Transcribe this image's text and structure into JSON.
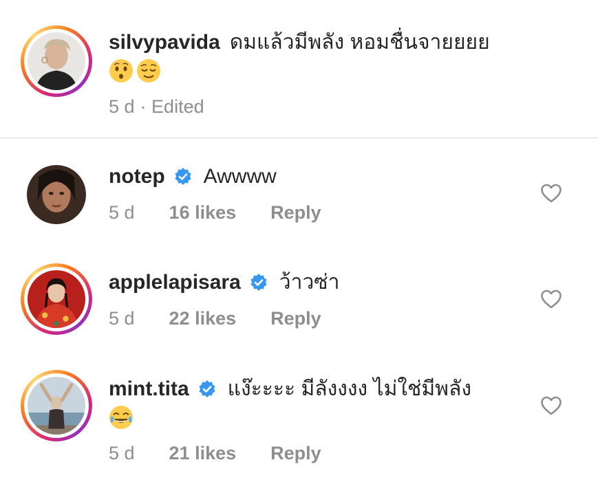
{
  "comments": [
    {
      "username": "silvypavida",
      "verified": false,
      "text": "ดมแล้วมีพลัง หอมชื่นจายยยย",
      "emojis": [
        "hushed-face",
        "relieved-face"
      ],
      "time": "5 d",
      "edited": "· Edited"
    },
    {
      "username": "notep",
      "verified": true,
      "text": "Awwww",
      "time": "5 d",
      "likes": "16 likes",
      "reply": "Reply"
    },
    {
      "username": "applelapisara",
      "verified": true,
      "text": "ว้าวซ่า",
      "time": "5 d",
      "likes": "22 likes",
      "reply": "Reply"
    },
    {
      "username": "mint.tita",
      "verified": true,
      "text": "แง๊ะะะะ มีลังงงง ไม่ใช่มีพลัง",
      "emojis": [
        "face-with-tears-of-joy"
      ],
      "time": "5 d",
      "likes": "21 likes",
      "reply": "Reply"
    }
  ],
  "colors": {
    "verified_badge": "#3897f0",
    "secondary_text": "#8e8e8e",
    "divider": "#dbdbdb"
  },
  "icons": [
    "heart-outline-icon",
    "verified-badge-icon"
  ]
}
